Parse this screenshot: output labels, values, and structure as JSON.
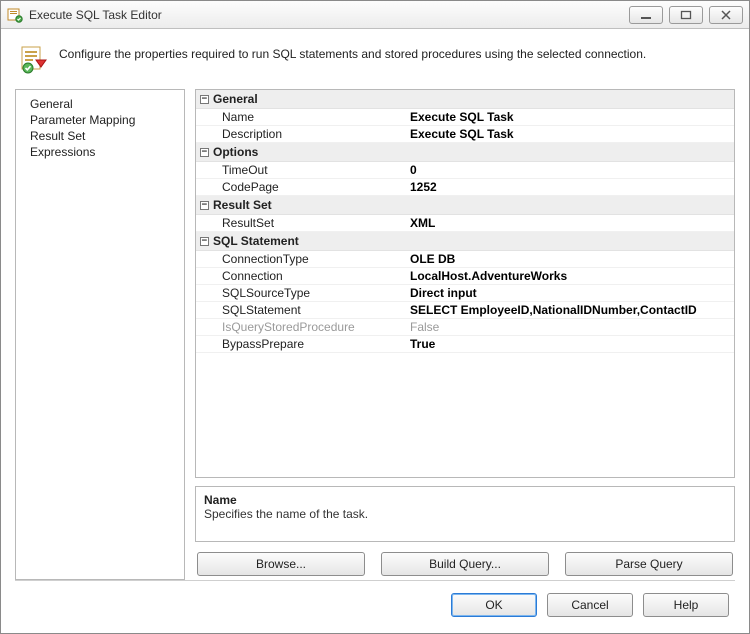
{
  "window": {
    "title": "Execute SQL Task Editor"
  },
  "intro": {
    "text": "Configure the properties required to run SQL statements and stored procedures using the selected connection."
  },
  "sidebar": {
    "items": [
      {
        "label": "General"
      },
      {
        "label": "Parameter Mapping"
      },
      {
        "label": "Result Set"
      },
      {
        "label": "Expressions"
      }
    ]
  },
  "grid": {
    "sections": [
      {
        "title": "General",
        "rows": [
          {
            "label": "Name",
            "value": "Execute SQL Task"
          },
          {
            "label": "Description",
            "value": "Execute SQL Task"
          }
        ]
      },
      {
        "title": "Options",
        "rows": [
          {
            "label": "TimeOut",
            "value": "0"
          },
          {
            "label": "CodePage",
            "value": "1252"
          }
        ]
      },
      {
        "title": "Result Set",
        "rows": [
          {
            "label": "ResultSet",
            "value": "XML"
          }
        ]
      },
      {
        "title": "SQL Statement",
        "rows": [
          {
            "label": "ConnectionType",
            "value": "OLE DB"
          },
          {
            "label": "Connection",
            "value": "LocalHost.AdventureWorks"
          },
          {
            "label": "SQLSourceType",
            "value": "Direct input"
          },
          {
            "label": "SQLStatement",
            "value": "SELECT EmployeeID,NationalIDNumber,ContactID"
          },
          {
            "label": "IsQueryStoredProcedure",
            "value": "False",
            "disabled": true
          },
          {
            "label": "BypassPrepare",
            "value": "True"
          }
        ]
      }
    ]
  },
  "help": {
    "title": "Name",
    "desc": "Specifies the name of the task."
  },
  "midButtons": {
    "browse": "Browse...",
    "buildQuery": "Build Query...",
    "parseQuery": "Parse Query"
  },
  "footer": {
    "ok": "OK",
    "cancel": "Cancel",
    "help": "Help"
  }
}
